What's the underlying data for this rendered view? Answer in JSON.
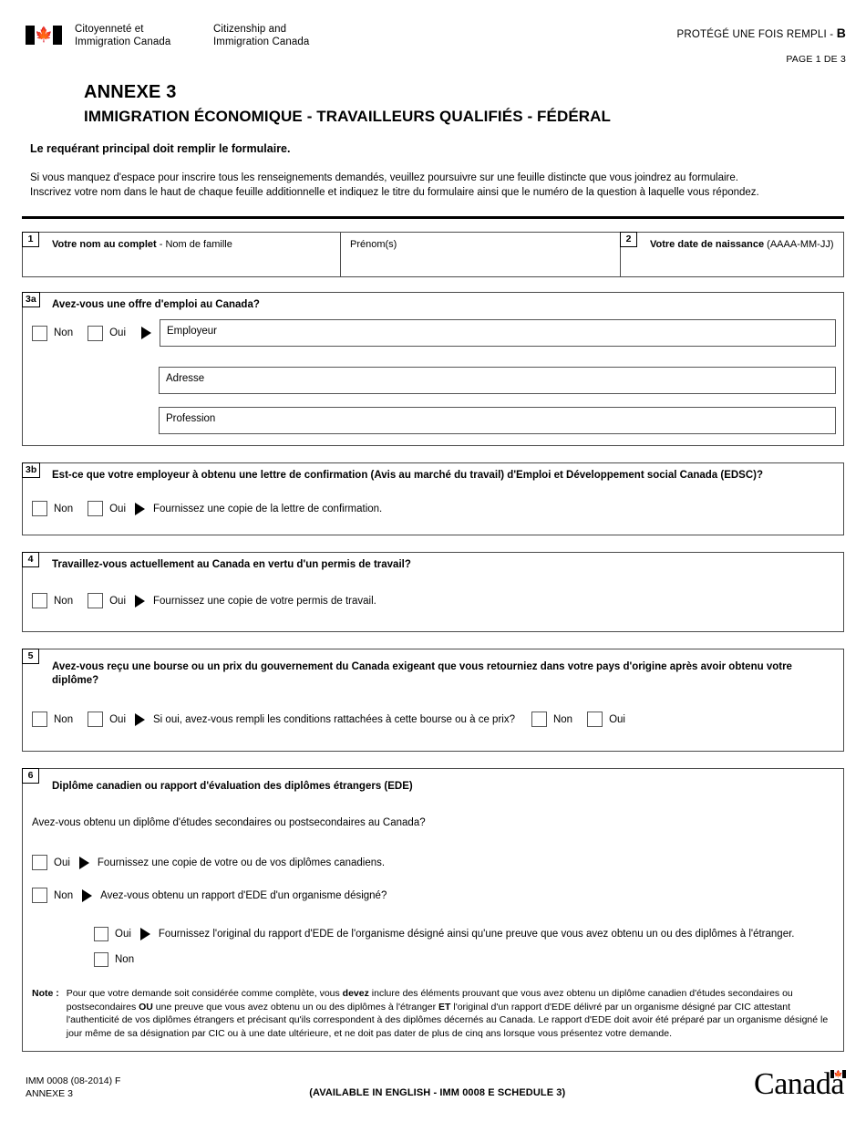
{
  "header": {
    "flag_icon": "canada-flag-icon",
    "dept_fr_line1": "Citoyenneté et",
    "dept_fr_line2": "Immigration Canada",
    "dept_en_line1": "Citizenship and",
    "dept_en_line2": "Immigration Canada",
    "protected_label": "PROTÉGÉ UNE FOIS REMPLI - ",
    "protected_letter": "B",
    "page_number": "PAGE 1 DE 3"
  },
  "titles": {
    "line1": "ANNEXE 3",
    "line2": "IMMIGRATION ÉCONOMIQUE - TRAVAILLEURS QUALIFIÉS - FÉDÉRAL"
  },
  "intro": {
    "bold": "Le requérant principal doit remplir le formulaire.",
    "paragraph_line1": "Si vous manquez d'espace pour inscrire tous les renseignements demandés, veuillez poursuivre sur une feuille distincte que vous joindrez au formulaire.",
    "paragraph_line2": "Inscrivez votre nom dans le haut de chaque feuille additionnelle et indiquez le titre du formulaire ainsi que le numéro de la question à laquelle vous répondez."
  },
  "q1": {
    "badge": "1",
    "label_bold": "Votre nom au complet",
    "label_rest": " - Nom de famille",
    "value": "",
    "given_names_label": "Prénom(s)",
    "given_names_value": ""
  },
  "q2": {
    "badge": "2",
    "label_bold": "Votre date de naissance",
    "label_rest": " (AAAA-MM-JJ)",
    "value": ""
  },
  "q3a": {
    "badge": "3a",
    "title": "Avez-vous une offre d'emploi au Canada?",
    "option_no": "Non",
    "option_yes": "Oui",
    "employer_label": "Employeur",
    "employer_value": "",
    "address_label": "Adresse",
    "address_value": "",
    "occupation_label": "Profession",
    "occupation_value": ""
  },
  "q3b": {
    "badge": "3b",
    "title": "Est-ce que votre employeur à obtenu une lettre de confirmation (Avis au marché du travail) d'Emploi et Développement social Canada (EDSC)?",
    "option_no": "Non",
    "option_yes": "Oui",
    "followup": "Fournissez une copie de la lettre de confirmation."
  },
  "q4": {
    "badge": "4",
    "title": "Travaillez-vous actuellement au Canada en vertu d'un permis de travail?",
    "option_no": "Non",
    "option_yes": "Oui",
    "followup": "Fournissez une copie de votre permis de travail."
  },
  "q5": {
    "badge": "5",
    "title": "Avez-vous reçu une bourse ou un prix du gouvernement du Canada exigeant que vous retourniez dans votre pays d'origine après avoir obtenu votre diplôme?",
    "option_no": "Non",
    "option_yes": "Oui",
    "followup": "Si oui, avez-vous rempli les conditions rattachées à cette bourse ou à ce prix?",
    "followup_no": "Non",
    "followup_yes": "Oui"
  },
  "q6": {
    "badge": "6",
    "title": "Diplôme canadien ou rapport d'évaluation des diplômes étrangers (EDE)",
    "question": "Avez-vous obtenu un diplôme d'études secondaires ou postsecondaires au Canada?",
    "yes_label": "Oui",
    "yes_followup": "Fournissez une copie de votre ou de vos diplômes canadiens.",
    "no_label": "Non",
    "no_followup": "Avez-vous obtenu un rapport d'EDE d'un organisme désigné?",
    "sub_yes_label": "Oui",
    "sub_yes_followup": "Fournissez l'original du rapport d'EDE de l'organisme désigné ainsi qu'une preuve que vous avez obtenu un ou des diplômes à l'étranger.",
    "sub_no_label": "Non",
    "note_label": "Note :",
    "note_part1": "Pour que votre demande soit considérée comme complète, vous ",
    "note_bold1": "devez",
    "note_part2": " inclure des éléments prouvant que vous avez obtenu un diplôme canadien d'études secondaires ou postsecondaires ",
    "note_bold2": "OU",
    "note_part3": " une preuve que vous avez obtenu un ou des diplômes à l'étranger ",
    "note_bold3": "ET",
    "note_part4": " l'original d'un rapport d'EDE délivré par un organisme désigné par CIC attestant l'authenticité de vos diplômes étrangers et précisant qu'ils correspondent à des diplômes décernés au Canada. Le rapport d'EDE doit avoir été préparé par un organisme désigné le jour même de sa désignation par CIC ou à une date ultérieure, et ne doit pas dater de plus de cinq ans lorsque vous présentez votre demande."
  },
  "footer": {
    "form_code": "IMM 0008 (08-2014) F",
    "annex": "ANNEXE 3",
    "available": "(AVAILABLE IN ENGLISH - IMM 0008 E SCHEDULE 3)",
    "wordmark": "Canada"
  },
  "colors": {
    "text": "#000000",
    "border": "#4a4a4a",
    "background": "#ffffff"
  }
}
